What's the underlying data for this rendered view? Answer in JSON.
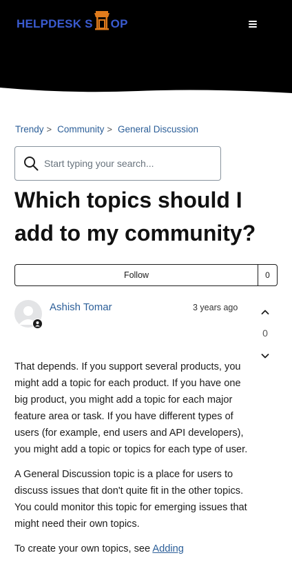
{
  "brand": {
    "logo_left": "HELPDESK S",
    "logo_right": "OP",
    "logo_color": "#3a5bd0",
    "logo_icon_color": "#e07b1c"
  },
  "header": {
    "menu_icon": "hamburger-icon",
    "bg_color": "#000000"
  },
  "breadcrumb": {
    "items": [
      "Trendy",
      "Community",
      "General Discussion"
    ],
    "separator": ">"
  },
  "search": {
    "placeholder": "Start typing your search...",
    "value": "",
    "icon": "search-icon"
  },
  "post": {
    "title": "Which topics should I add to my community?",
    "follow_label": "Follow",
    "follow_count": "0",
    "author": "Ashish Tomar",
    "timestamp": "3 years ago",
    "vote_count": "0",
    "paragraphs": [
      "That depends. If you support several products, you might add a topic for each product. If you have one big product, you might add a topic for each major feature area or task. If you have different types of users (for example, end users and API developers), you might add a topic or topics for each type of user.",
      "A General Discussion topic is a place for users to discuss issues that don't quite fit in the other topics. You could monitor this topic for emerging issues that might need their own topics."
    ],
    "last_paragraph_prefix": "To create your own topics, see ",
    "last_paragraph_link": "Adding"
  },
  "colors": {
    "link": "#2b5e98",
    "text": "#1b1b1b"
  }
}
